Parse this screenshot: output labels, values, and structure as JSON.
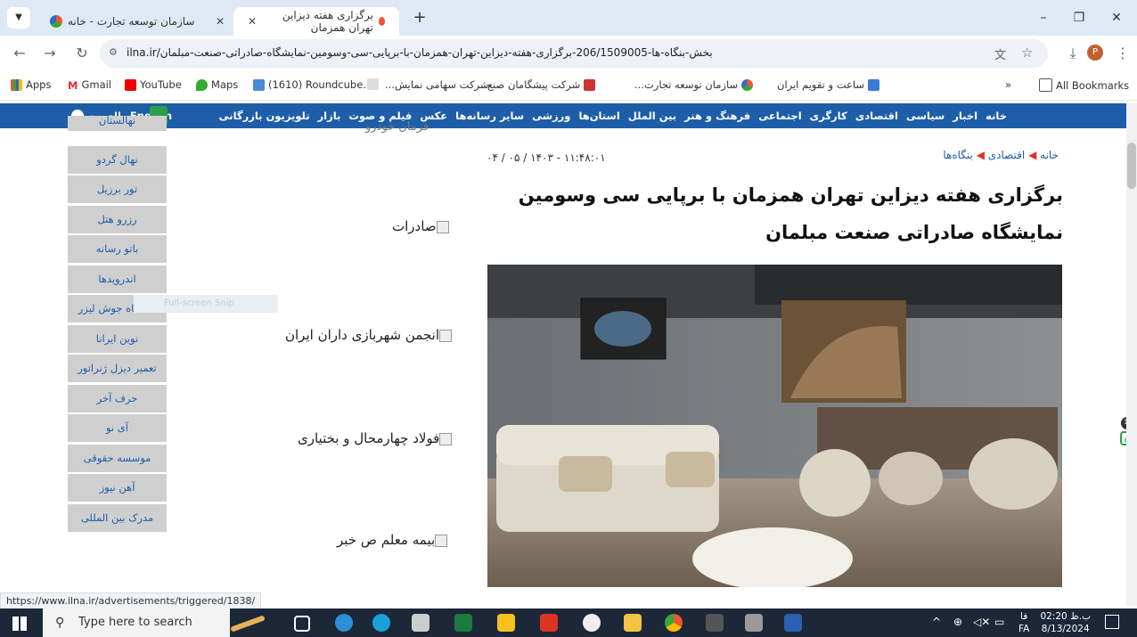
{
  "browser": {
    "tabs": [
      {
        "label": "سازمان توسعه تجارت - خانه",
        "active": false
      },
      {
        "label": "سازمان توسعه تجارت - خانه",
        "active": false
      },
      {
        "label": "برگزاری هفته دیزاین تهران همزمان",
        "active": true
      }
    ],
    "new_tab_label": "+",
    "url": "ilna.ir/بخش-بنگاه-ها-206/1509005-برگزاری-هفته-دیزاین-تهران-همزمان-با-برپایی-سی-وسومین-نمایشگاه-صادراتی-صنعت-مبلمان",
    "profile_initial": "P"
  },
  "bookmarks": {
    "items": [
      "Apps",
      "Gmail",
      "YouTube",
      "Maps",
      "(1610) Roundcube...",
      "",
      "شرکت سهامی نمایش...",
      "شرکت پیشگامان صنع...",
      "سازمان توسعه تجارت...",
      "ساعت و تقویم ایران"
    ],
    "overflow": "»",
    "all_bookmarks": "All Bookmarks"
  },
  "site_nav": {
    "items": [
      "خانه",
      "اخبار",
      "سیاسی",
      "اقتصادی",
      "کارگری",
      "اجتماعی",
      "فرهنگ و هنر",
      "بین الملل",
      "استان‌ها",
      "ورزشی",
      "سایر رسانه‌ها",
      "عکس",
      "فیلم و صوت",
      "بازار",
      "تلویزیون بازرگانی"
    ],
    "lang_english": "English",
    "lang_arabic": "العربیه"
  },
  "sidebar": {
    "items": [
      "نهالستان",
      "نهال گردو",
      "تور برزیل",
      "رزرو هتل",
      "باتو رسانه",
      "اندرویدها",
      "دستگاه جوش لیزر",
      "نوین ایرانا",
      "تعمیر دیزل ژنراتور",
      "حرف آخر",
      "آی نو",
      "موسسه حقوقی",
      "آهن نیوز",
      "مدرک بین المللی"
    ]
  },
  "ads": {
    "top_partial": "فرمان خودرو",
    "items": [
      "صادرات",
      "انجمن شهربازی داران ایران",
      "فولاد چهارمحال و بختیاری",
      "بیمه معلم ص خبر"
    ]
  },
  "snip_label": "Full-screen Snip",
  "article": {
    "breadcrumb": [
      "خانه",
      "اقتصادی",
      "بنگاه‌ها"
    ],
    "date": "۱۱:۴۸:۰۱ - ۱۴۰۳ / ۰۵ / ۰۴",
    "headline": "برگزاری هفته دیزاین تهران همزمان با برپایی سی وسومین نمایشگاه صادراتی صنعت مبلمان"
  },
  "status_url": "https://www.ilna.ir/advertisements/triggered/1838/",
  "taskbar": {
    "search_placeholder": "Type here to search",
    "time": "02:20 ب.ظ",
    "date": "8/13/2024",
    "lang": "FA",
    "lang_sub": "فا"
  },
  "colors": {
    "site_blue": "#1e5ea8",
    "sidebar_gray": "#cfcfcf",
    "tabstrip": "#dfe9f6"
  }
}
